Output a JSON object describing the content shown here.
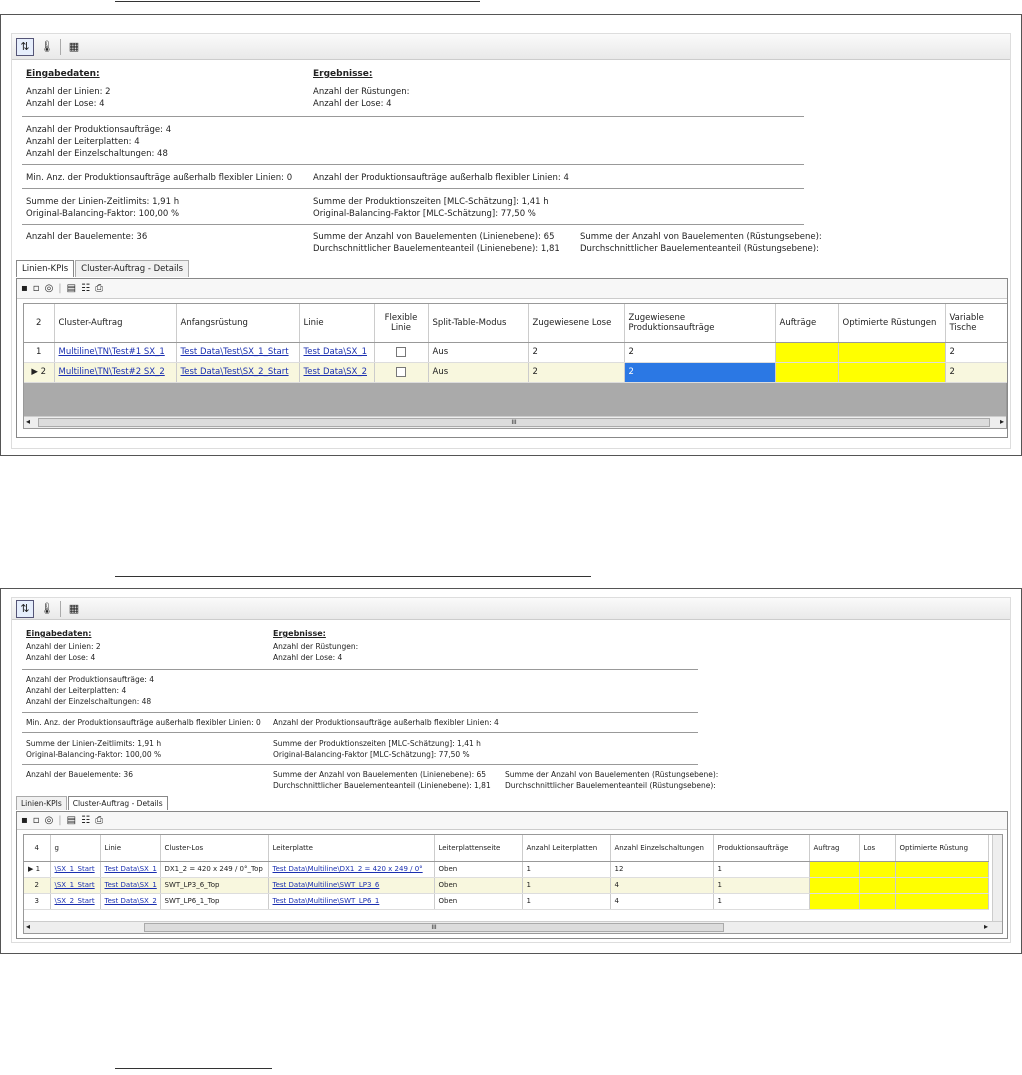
{
  "panel1": {
    "toolbar": {
      "icons": [
        "sort-icon",
        "thermometer-icon",
        "grid-icon"
      ]
    },
    "inputs": {
      "header": "Eingabedaten:",
      "lines": "Anzahl der Linien: 2",
      "lots": "Anzahl der Lose: 4",
      "orders": "Anzahl der Produktionsaufträge: 4",
      "boards": "Anzahl der Leiterplatten: 4",
      "circuits": "Anzahl der Einzelschaltungen: 48",
      "min_orders": "Min. Anz. der Produktionsaufträge außerhalb flexibler Linien: 0",
      "time_limits": "Summe der Linien-Zeitlimits: 1,91 h",
      "balancing": "Original-Balancing-Faktor: 100,00 %",
      "components": "Anzahl der Bauelemente: 36"
    },
    "results": {
      "header": "Ergebnisse:",
      "setups": "Anzahl der Rüstungen:",
      "lots": "Anzahl der Lose: 4",
      "orders_outside": "Anzahl der Produktionsaufträge außerhalb flexibler Linien: 4",
      "prod_times": "Summe der Produktionszeiten [MLC-Schätzung]: 1,41 h",
      "balancing": "Original-Balancing-Faktor [MLC-Schätzung]: 77,50 %",
      "sum_components_line": "Summe der Anzahl von Bauelementen (Linienebene): 65",
      "avg_components_line": "Durchschnittlicher Bauelementeanteil (Linienebene): 1,81",
      "sum_components_setup": "Summe der Anzahl von Bauelementen (Rüstungsebene):",
      "avg_components_setup": "Durchschnittlicher Bauelementeanteil (Rüstungsebene):"
    },
    "tabs": [
      "Linien-KPIs",
      "Cluster-Auftrag - Details"
    ],
    "grid": {
      "count": "2",
      "headers": [
        "Cluster-Auftrag",
        "Anfangsrüstung",
        "Linie",
        "Flexible Linie",
        "Split-Table-Modus",
        "Zugewiesene Lose",
        "Zugewiesene Produktionsaufträge",
        "Aufträge",
        "Optimierte Rüstungen",
        "Variable Tische"
      ],
      "rows": [
        {
          "num": "1",
          "cluster": "Multiline\\TN\\Test#1 SX_1",
          "setup": "Test Data\\Test\\SX_1_Start",
          "line": "Test Data\\SX_1",
          "split": "Aus",
          "lots": "2",
          "orders": "2",
          "tables": "2"
        },
        {
          "num": "2",
          "cluster": "Multiline\\TN\\Test#2 SX_2",
          "setup": "Test Data\\Test\\SX_2_Start",
          "line": "Test Data\\SX_2",
          "split": "Aus",
          "lots": "2",
          "orders": "2",
          "tables": "2"
        }
      ],
      "scroll_glyph": "III"
    }
  },
  "panel2": {
    "inputs": {
      "header": "Eingabedaten:",
      "lines": "Anzahl der Linien: 2",
      "lots": "Anzahl der Lose: 4",
      "orders": "Anzahl der Produktionsaufträge: 4",
      "boards": "Anzahl der Leiterplatten: 4",
      "circuits": "Anzahl der Einzelschaltungen: 48",
      "min_orders": "Min. Anz. der Produktionsaufträge außerhalb flexibler Linien: 0",
      "time_limits": "Summe der Linien-Zeitlimits: 1,91 h",
      "balancing": "Original-Balancing-Faktor: 100,00 %",
      "components": "Anzahl der Bauelemente: 36"
    },
    "results": {
      "header": "Ergebnisse:",
      "setups": "Anzahl der Rüstungen:",
      "lots": "Anzahl der Lose: 4",
      "orders_outside": "Anzahl der Produktionsaufträge außerhalb flexibler Linien: 4",
      "prod_times": "Summe der Produktionszeiten [MLC-Schätzung]: 1,41 h",
      "balancing": "Original-Balancing-Faktor [MLC-Schätzung]: 77,50 %",
      "sum_components_line": "Summe der Anzahl von Bauelementen (Linienebene): 65",
      "avg_components_line": "Durchschnittlicher Bauelementeanteil (Linienebene): 1,81",
      "sum_components_setup": "Summe der Anzahl von Bauelementen (Rüstungsebene):",
      "avg_components_setup": "Durchschnittlicher Bauelementeanteil (Rüstungsebene):"
    },
    "tabs": [
      "Linien-KPIs",
      "Cluster-Auftrag - Details"
    ],
    "grid": {
      "count": "4",
      "headers": [
        "g",
        "Linie",
        "Cluster-Los",
        "Leiterplatte",
        "Leiterplattenseite",
        "Anzahl Leiterplatten",
        "Anzahl Einzelschaltungen",
        "Produktionsaufträge",
        "Auftrag",
        "Los",
        "Optimierte Rüstung"
      ],
      "rows": [
        {
          "num": "1",
          "setup": "\\SX_1_Start",
          "line": "Test Data\\SX_1",
          "lot": "DX1_2 = 420 x 249 / 0°_Top",
          "board": "Test Data\\Multiline\\DX1_2 = 420 x 249 / 0°",
          "side": "Oben",
          "boards": "1",
          "circuits": "12",
          "orders": "1"
        },
        {
          "num": "2",
          "setup": "\\SX_1_Start",
          "line": "Test Data\\SX_1",
          "lot": "SWT_LP3_6_Top",
          "board": "Test Data\\Multiline\\SWT_LP3_6",
          "side": "Oben",
          "boards": "1",
          "circuits": "4",
          "orders": "1"
        },
        {
          "num": "3",
          "setup": "\\SX_2_Start",
          "line": "Test Data\\SX_2",
          "lot": "SWT_LP6_1_Top",
          "board": "Test Data\\Multiline\\SWT_LP6_1",
          "side": "Oben",
          "boards": "1",
          "circuits": "4",
          "orders": "1"
        }
      ],
      "scroll_glyph": "III"
    }
  }
}
